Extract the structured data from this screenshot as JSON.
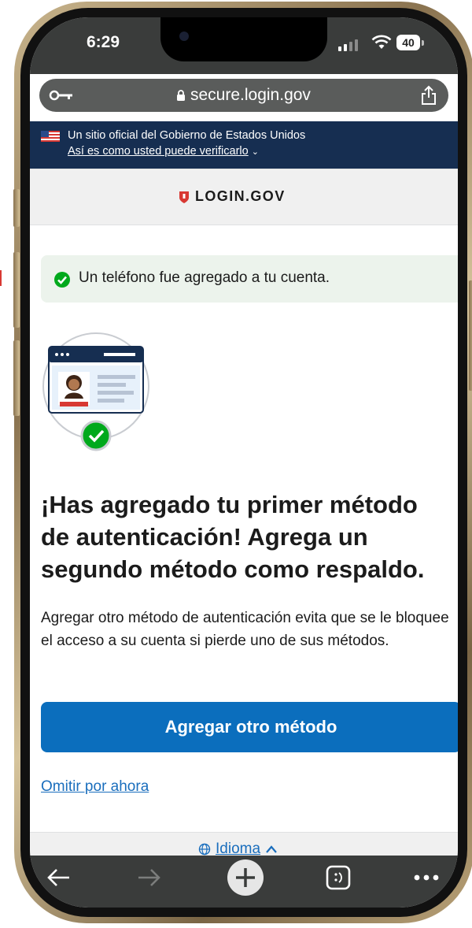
{
  "status_bar": {
    "time": "6:29",
    "battery": "40"
  },
  "browser": {
    "url": "secure.login.gov"
  },
  "gov_banner": {
    "official_text": "Un sitio oficial del Gobierno de Estados Unidos",
    "verify_link": "Así es como usted puede verificarlo"
  },
  "header": {
    "logo_text": "LOGIN.GOV"
  },
  "alert": {
    "message": "Un teléfono fue agregado a tu cuenta."
  },
  "main": {
    "heading": "¡Has agregado tu primer método de autenticación! Agrega un segundo método como respaldo.",
    "description": "Agregar otro método de autenticación evita que se le bloquee el acceso a su cuenta si pierde uno de sus métodos.",
    "primary_button": "Agregar otro método",
    "skip_link": "Omitir por ahora"
  },
  "footer": {
    "language_label": "Idioma"
  },
  "colors": {
    "accent": "#0b6ebd",
    "banner": "#162e51",
    "success": "#00a91c",
    "brand_red": "#d83933"
  }
}
